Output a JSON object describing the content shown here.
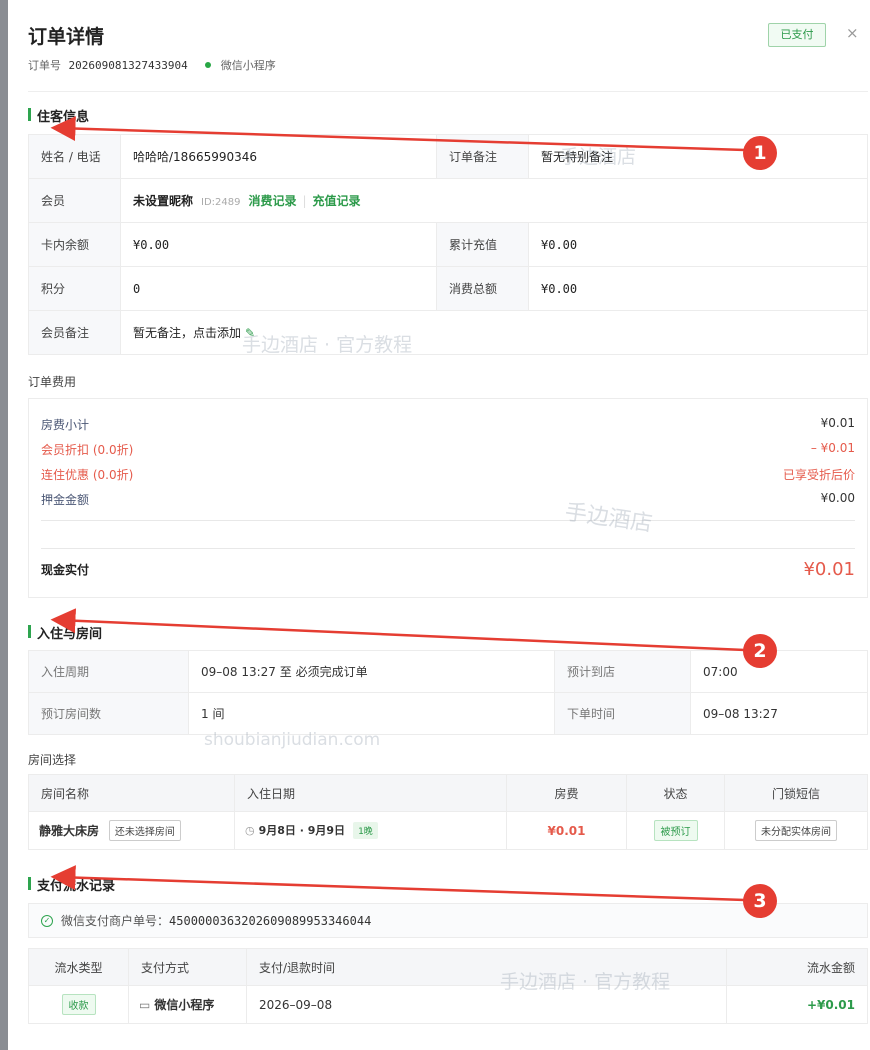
{
  "header": {
    "title": "订单详情",
    "order_label": "订单号",
    "order_number": "2026090813274339 04",
    "source": "微信小程序",
    "paid_badge": "已支付",
    "close": "×"
  },
  "guest": {
    "section_title": "住客信息",
    "name_label": "姓名 / 电话",
    "name_value": "哈哈哈/18665990346",
    "remark_label": "订单备注",
    "remark_value": "暂无特别备注",
    "member_label": "会员",
    "member_nick": "未设置昵称",
    "member_id": "ID:2489",
    "consume_link": "消费记录",
    "recharge_link": "充值记录",
    "balance_label": "卡内余额",
    "balance_value": "¥0.00",
    "total_recharge_label": "累计充值",
    "total_recharge_value": "¥0.00",
    "points_label": "积分",
    "points_value": "0",
    "total_spent_label": "消费总额",
    "total_spent_value": "¥0.00",
    "member_remark_label": "会员备注",
    "member_remark_value": "暂无备注，点击添加"
  },
  "fees": {
    "section_title": "订单费用",
    "room_subtotal_label": "房费小计",
    "room_subtotal_value": "¥0.01",
    "member_discount_label": "会员折扣 (0.0折)",
    "member_discount_value": "– ¥0.01",
    "stay_discount_label": "连住优惠 (0.0折)",
    "stay_discount_value": "已享受折后价",
    "deposit_label": "押金金额",
    "deposit_value": "¥0.00",
    "cash_paid_label": "现金实付",
    "cash_paid_value": "¥0.01"
  },
  "checkin": {
    "section_title": "入住与房间",
    "period_label": "入住周期",
    "period_value": "09–08 13:27 至 必须完成订单",
    "arrival_label": "预计到店",
    "arrival_value": "07:00",
    "rooms_label": "预订房间数",
    "rooms_value": "1 间",
    "order_time_label": "下单时间",
    "order_time_value": "09–08 13:27"
  },
  "room_select": {
    "section_title": "房间选择",
    "headers": [
      "房间名称",
      "入住日期",
      "房费",
      "状态",
      "门锁短信"
    ],
    "row": {
      "name": "静雅大床房",
      "name_tag": "还未选择房间",
      "dates": "9月8日 · 9月9日",
      "nights": "1晚",
      "price": "¥0.01",
      "status": "被预订",
      "lock": "未分配实体房间"
    }
  },
  "payments": {
    "section_title": "支付流水记录",
    "merchant_label": "微信支付商户单号：",
    "merchant_number": "4500000363202609089953346044",
    "headers": [
      "流水类型",
      "支付方式",
      "支付/退款时间",
      "流水金额"
    ],
    "row": {
      "type": "收款",
      "method": "微信小程序",
      "time": "2026–09–08",
      "amount": "+¥0.01"
    }
  },
  "annotations": [
    "1",
    "2",
    "3"
  ],
  "watermarks": {
    "brand": "手边酒店",
    "tutorial": "手边酒店 · 官方教程",
    "domain": "shoubianjiudian.com"
  },
  "colors": {
    "accent_green": "#2c9a4a",
    "alert_red": "#e55a4b",
    "arrow_red": "#e53d32"
  }
}
